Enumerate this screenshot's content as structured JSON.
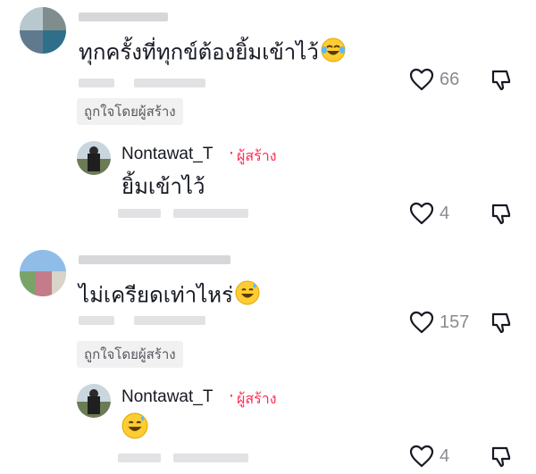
{
  "comments": [
    {
      "text": "ทุกครั้งที่ทุกข์ต้องยิ้มเข้าไว้",
      "emoji": "joy-emoji",
      "like_count": "66",
      "liked_by_creator": "ถูกใจโดยผู้สร้าง"
    },
    {
      "text": "ไม่เครียดเท่าไหร่",
      "emoji": "sweat-smile-emoji",
      "like_count": "157",
      "liked_by_creator": "ถูกใจโดยผู้สร้าง"
    }
  ],
  "replies": [
    {
      "username": "Nontawat_T",
      "creator_badge": "ผู้สร้าง",
      "text": "ยิ้มเข้าไว้",
      "like_count": "4"
    },
    {
      "username": "Nontawat_T",
      "creator_badge": "ผู้สร้าง",
      "text": "",
      "emoji": "sweat-smile-emoji",
      "like_count": "4"
    }
  ],
  "colors": {
    "creator_accent": "#fe2c55",
    "muted_text": "#8a8b91",
    "chip_bg": "#f1f1f2"
  }
}
